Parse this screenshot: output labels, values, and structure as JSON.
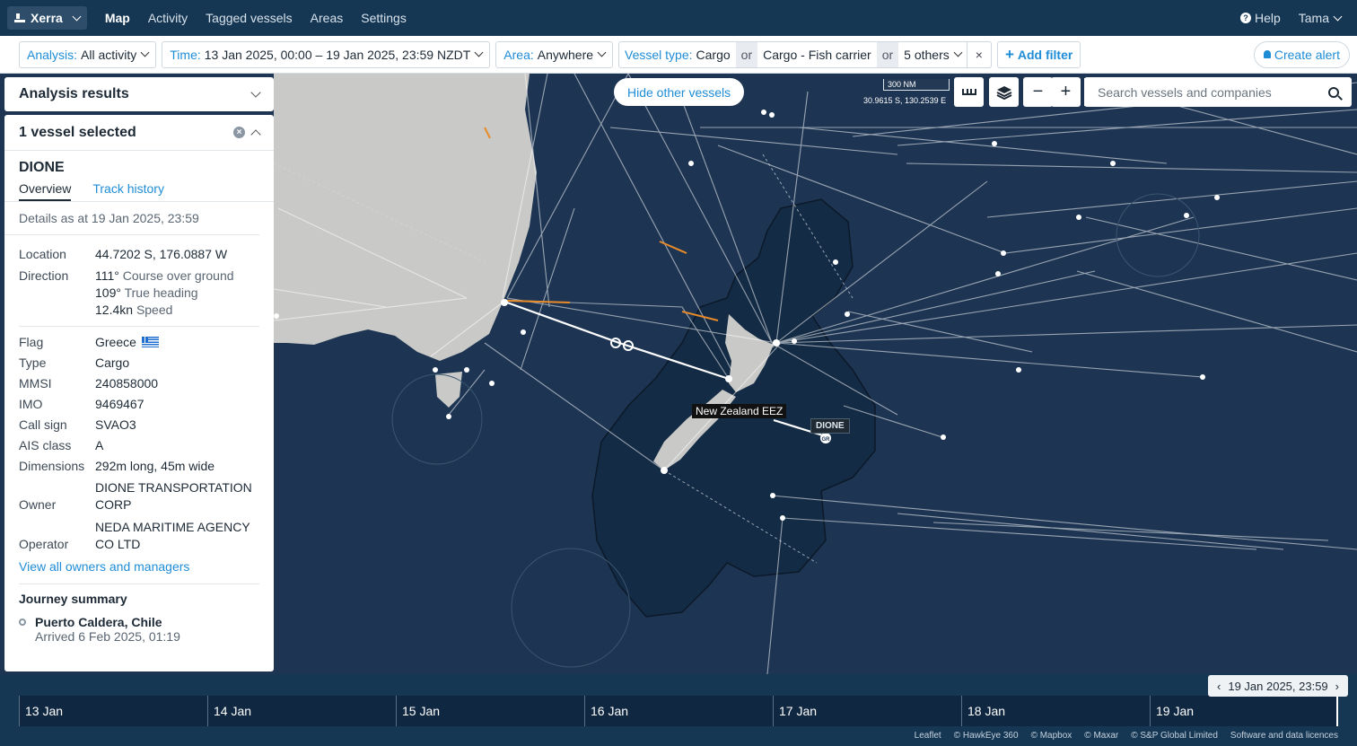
{
  "app": {
    "brand": "Xerra",
    "nav": [
      "Map",
      "Activity",
      "Tagged vessels",
      "Areas",
      "Settings"
    ],
    "help": "Help",
    "user": "Tama"
  },
  "filters": {
    "analysis_key": "Analysis:",
    "analysis_val": "All activity",
    "time_key": "Time:",
    "time_val": "13 Jan 2025, 00:00 – 19 Jan 2025, 23:59 NZDT",
    "area_key": "Area:",
    "area_val": "Anywhere",
    "vessel_key": "Vessel type:",
    "vessel_val1": "Cargo",
    "or": "or",
    "vessel_val2": "Cargo - Fish carrier",
    "vessel_val3": "5 others",
    "remove": "×",
    "add_filter": "Add filter",
    "create_alert": "Create alert"
  },
  "panel": {
    "analysis_title": "Analysis results",
    "selected_title": "1 vessel selected",
    "vessel_name": "DIONE",
    "tabs": [
      "Overview",
      "Track history"
    ],
    "as_at": "Details as at 19 Jan 2025, 23:59",
    "location_label": "Location",
    "location_value": "44.7202 S, 176.0887 W",
    "direction_label": "Direction",
    "course": "111°",
    "course_label": "Course over ground",
    "heading": "109°",
    "heading_label": "True heading",
    "speed": "12.4kn",
    "speed_label": "Speed",
    "details": [
      {
        "label": "Flag",
        "value": "Greece"
      },
      {
        "label": "Type",
        "value": "Cargo"
      },
      {
        "label": "MMSI",
        "value": "240858000"
      },
      {
        "label": "IMO",
        "value": "9469467"
      },
      {
        "label": "Call sign",
        "value": "SVAO3"
      },
      {
        "label": "AIS class",
        "value": "A"
      },
      {
        "label": "Dimensions",
        "value": "292m long, 45m wide"
      }
    ],
    "owner_label": "Owner",
    "owner_line1": "DIONE TRANSPORTATION",
    "owner_line2": "CORP",
    "operator_label": "Operator",
    "operator_line1": "NEDA MARITIME AGENCY",
    "operator_line2": "CO LTD",
    "view_all": "View all owners and managers",
    "journey_title": "Journey summary",
    "journey_port": "Puerto Caldera, Chile",
    "journey_arrival": "Arrived 6 Feb 2025, 01:19"
  },
  "map": {
    "hide_other": "Hide other vessels",
    "scale": "300 NM",
    "coords": "30.9615 S, 130.2539 E",
    "search_placeholder": "Search vessels and companies",
    "eez_label": "New Zealand EEZ",
    "vessel_label": "DIONE",
    "colors": {
      "sea": "#1d3553",
      "land": "#c9cac8",
      "track": "#ffffff",
      "eez": "#142a44"
    }
  },
  "timeline": {
    "current": "19 Jan 2025, 23:59",
    "days": [
      "13 Jan",
      "14 Jan",
      "15 Jan",
      "16 Jan",
      "17 Jan",
      "18 Jan",
      "19 Jan"
    ]
  },
  "credits": [
    "Leaflet",
    "© HawkEye 360",
    "© Mapbox",
    "© Maxar",
    "© S&P Global Limited",
    "Software and data licences"
  ]
}
